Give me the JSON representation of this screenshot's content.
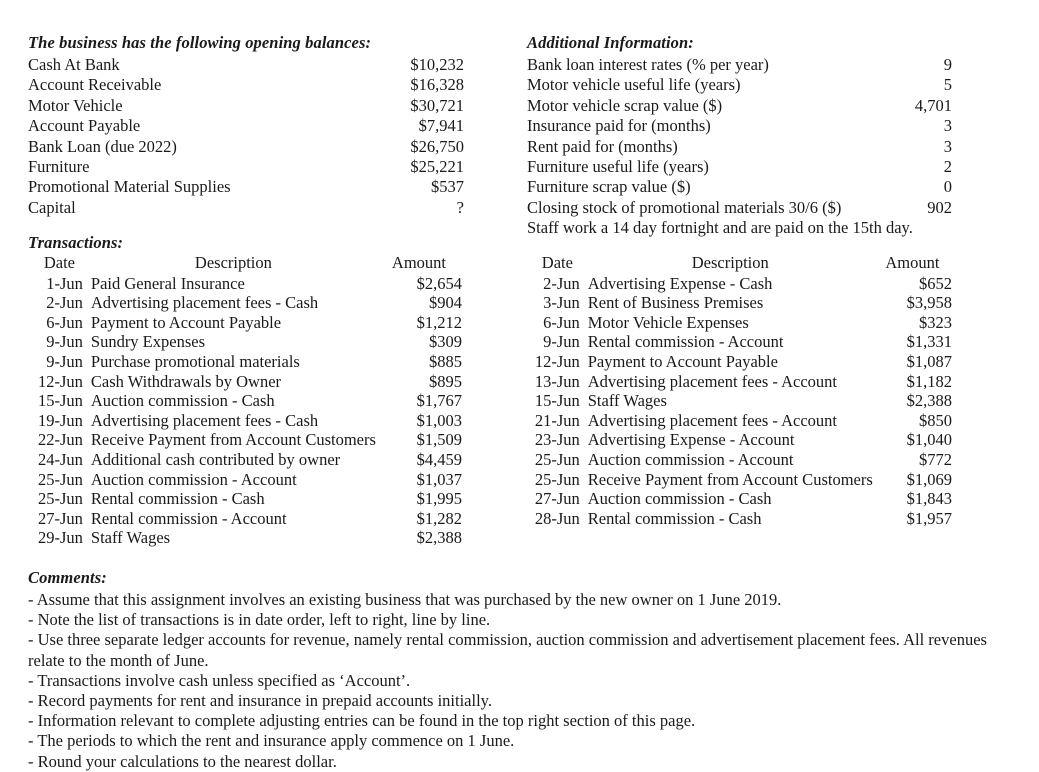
{
  "opening_balances": {
    "heading": "The business has the following opening balances:",
    "rows": [
      {
        "label": "Cash At Bank",
        "value": "$10,232"
      },
      {
        "label": "Account Receivable",
        "value": "$16,328"
      },
      {
        "label": "Motor Vehicle",
        "value": "$30,721"
      },
      {
        "label": "Account Payable",
        "value": "$7,941"
      },
      {
        "label": "Bank Loan (due 2022)",
        "value": "$26,750"
      },
      {
        "label": "Furniture",
        "value": "$25,221"
      },
      {
        "label": "Promotional Material Supplies",
        "value": "$537"
      },
      {
        "label": "Capital",
        "value": "?"
      }
    ]
  },
  "additional_information": {
    "heading": "Additional Information:",
    "rows": [
      {
        "label": "Bank loan interest rates (% per year)",
        "value": "9"
      },
      {
        "label": "Motor vehicle useful life (years)",
        "value": "5"
      },
      {
        "label": "Motor vehicle scrap value ($)",
        "value": "4,701"
      },
      {
        "label": "Insurance paid for (months)",
        "value": "3"
      },
      {
        "label": "Rent paid for (months)",
        "value": "3"
      },
      {
        "label": "Furniture useful life (years)",
        "value": "2"
      },
      {
        "label": "Furniture scrap value ($)",
        "value": "0"
      },
      {
        "label": "Closing stock of promotional materials 30/6 ($)",
        "value": "902"
      }
    ],
    "note": "Staff work a 14 day fortnight and are paid on the 15th day."
  },
  "transactions": {
    "heading": "Transactions:",
    "columns": {
      "date": "Date",
      "description": "Description",
      "amount": "Amount"
    },
    "left": [
      {
        "date": "1-Jun",
        "description": "Paid General Insurance",
        "amount": "$2,654"
      },
      {
        "date": "2-Jun",
        "description": "Advertising placement fees - Cash",
        "amount": "$904"
      },
      {
        "date": "6-Jun",
        "description": "Payment to Account Payable",
        "amount": "$1,212"
      },
      {
        "date": "9-Jun",
        "description": "Sundry Expenses",
        "amount": "$309"
      },
      {
        "date": "9-Jun",
        "description": "Purchase promotional materials",
        "amount": "$885"
      },
      {
        "date": "12-Jun",
        "description": "Cash Withdrawals by Owner",
        "amount": "$895"
      },
      {
        "date": "15-Jun",
        "description": "Auction commission - Cash",
        "amount": "$1,767"
      },
      {
        "date": "19-Jun",
        "description": "Advertising placement fees - Cash",
        "amount": "$1,003"
      },
      {
        "date": "22-Jun",
        "description": "Receive Payment from Account Customers",
        "amount": "$1,509"
      },
      {
        "date": "24-Jun",
        "description": "Additional cash contributed by owner",
        "amount": "$4,459"
      },
      {
        "date": "25-Jun",
        "description": "Auction commission - Account",
        "amount": "$1,037"
      },
      {
        "date": "25-Jun",
        "description": "Rental commission - Cash",
        "amount": "$1,995"
      },
      {
        "date": "27-Jun",
        "description": "Rental commission - Account",
        "amount": "$1,282"
      },
      {
        "date": "29-Jun",
        "description": "Staff Wages",
        "amount": "$2,388"
      }
    ],
    "right": [
      {
        "date": "2-Jun",
        "description": "Advertising Expense - Cash",
        "amount": "$652"
      },
      {
        "date": "3-Jun",
        "description": "Rent of Business Premises",
        "amount": "$3,958"
      },
      {
        "date": "6-Jun",
        "description": "Motor Vehicle Expenses",
        "amount": "$323"
      },
      {
        "date": "9-Jun",
        "description": "Rental commission - Account",
        "amount": "$1,331"
      },
      {
        "date": "12-Jun",
        "description": "Payment to Account Payable",
        "amount": "$1,087"
      },
      {
        "date": "13-Jun",
        "description": "Advertising placement fees - Account",
        "amount": "$1,182"
      },
      {
        "date": "15-Jun",
        "description": "Staff Wages",
        "amount": "$2,388"
      },
      {
        "date": "21-Jun",
        "description": "Advertising placement fees - Account",
        "amount": "$850"
      },
      {
        "date": "23-Jun",
        "description": "Advertising Expense - Account",
        "amount": "$1,040"
      },
      {
        "date": "25-Jun",
        "description": "Auction commission - Account",
        "amount": "$772"
      },
      {
        "date": "25-Jun",
        "description": "Receive Payment from Account Customers",
        "amount": "$1,069"
      },
      {
        "date": "27-Jun",
        "description": "Auction commission - Cash",
        "amount": "$1,843"
      },
      {
        "date": "28-Jun",
        "description": "Rental commission - Cash",
        "amount": "$1,957"
      }
    ]
  },
  "comments": {
    "heading": "Comments:",
    "lines": [
      "- Assume that this assignment involves an existing business that was purchased by the new owner on 1 June 2019.",
      "- Note the list of transactions is in date order, left to right, line by line.",
      "- Use three separate ledger accounts for revenue, namely rental commission, auction commission and advertisement placement fees. All revenues relate to the month of June.",
      "- Transactions involve cash unless specified as ‘Account’.",
      "- Record payments for rent and insurance in prepaid accounts initially.",
      "- Information relevant to complete adjusting entries can be found in the top right section of this page.",
      "- The periods to which the rent and insurance apply commence on 1 June.",
      "- Round your calculations to the nearest dollar."
    ]
  }
}
